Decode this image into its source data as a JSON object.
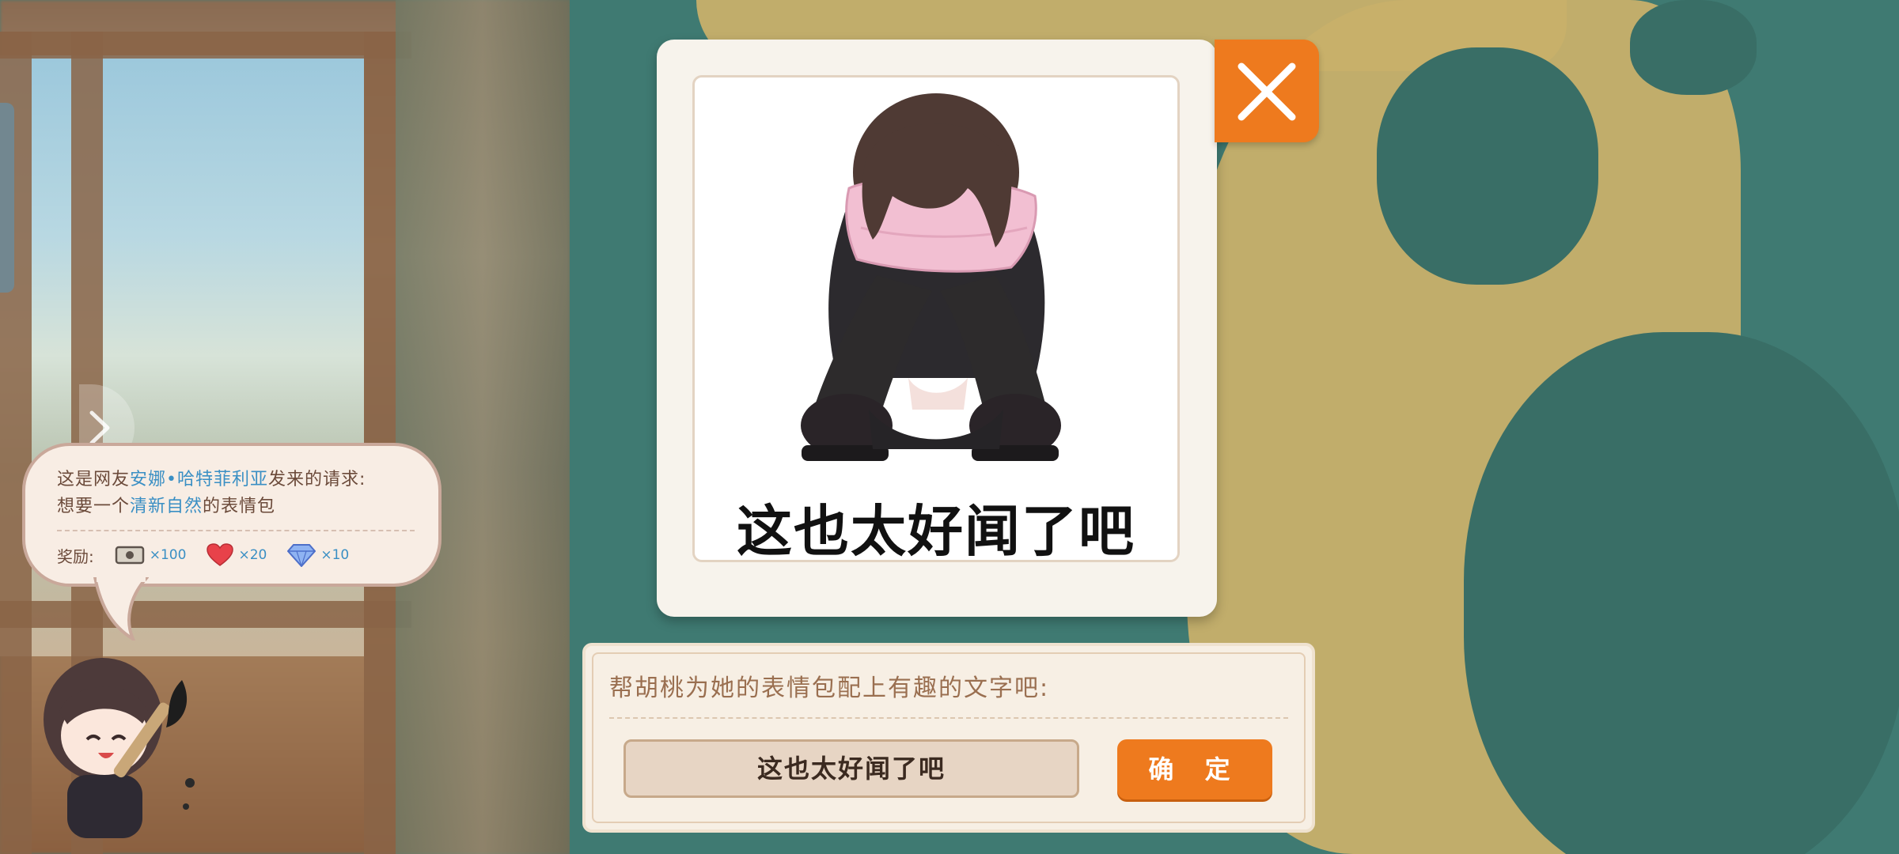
{
  "request": {
    "line1_prefix": "这是网友",
    "sender_name": "安娜•哈特菲利亚",
    "line1_suffix": "发来的请求:",
    "line2_prefix": "想要一个",
    "style_keyword": "清新自然",
    "line2_suffix": "的表情包",
    "reward_label": "奖励:",
    "rewards": [
      {
        "icon": "cash-icon",
        "qty": "×100"
      },
      {
        "icon": "heart-icon",
        "qty": "×20"
      },
      {
        "icon": "diamond-icon",
        "qty": "×10"
      }
    ]
  },
  "meme": {
    "caption": "这也太好闻了吧"
  },
  "editor": {
    "prompt": "帮胡桃为她的表情包配上有趣的文字吧:",
    "input_value": "这也太好闻了吧",
    "confirm_label": "确 定"
  },
  "colors": {
    "accent_orange": "#ee7a1e",
    "highlight_blue": "#3a8fc4",
    "panel_bg": "#f7efe4"
  }
}
